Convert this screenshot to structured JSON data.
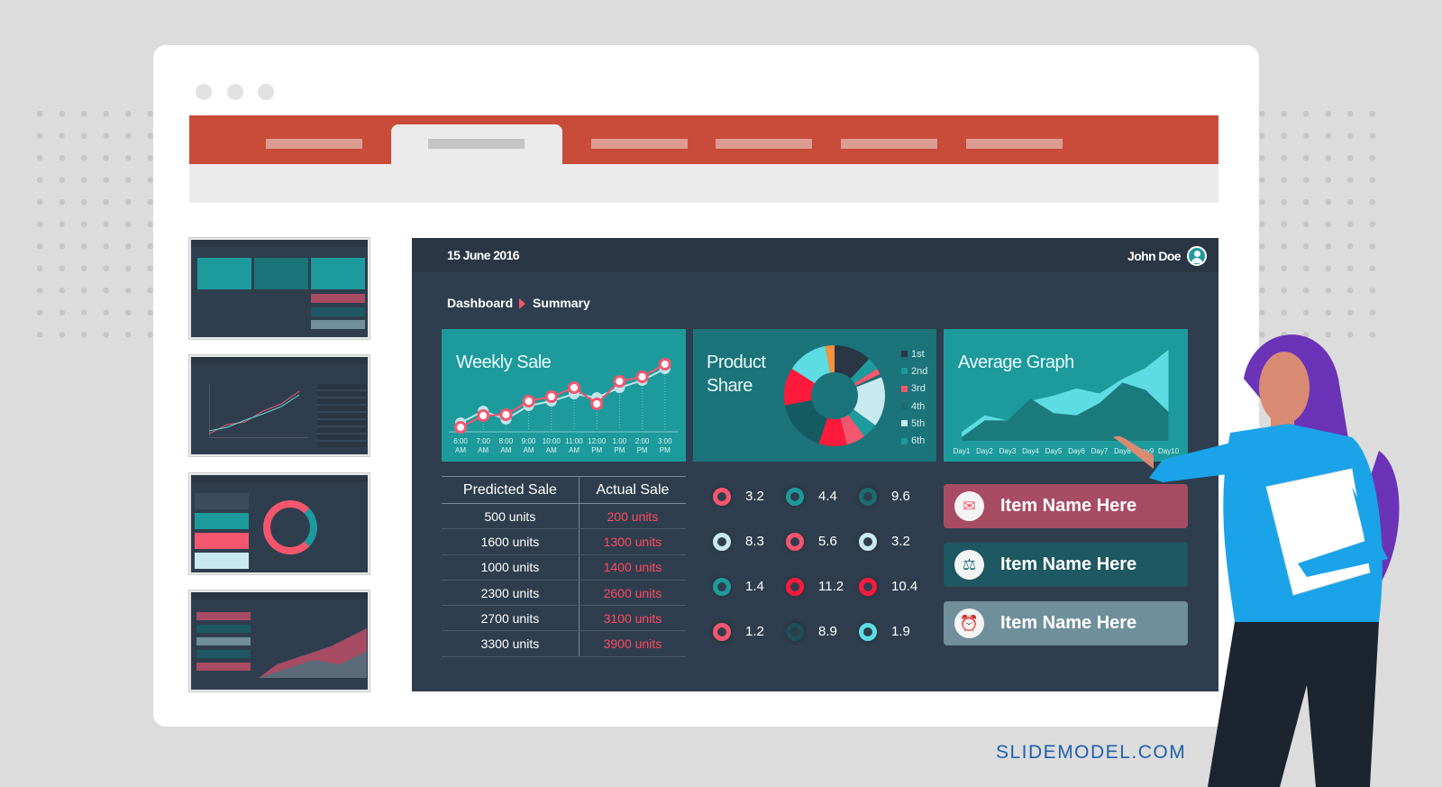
{
  "dashboard": {
    "date": "15 June 2016",
    "user": "John Doe",
    "breadcrumb": [
      "Dashboard",
      "Summary"
    ],
    "weekly_sale": {
      "title": "Weekly Sale",
      "chart_data": {
        "type": "line",
        "categories": [
          "6:00 AM",
          "7:00 AM",
          "8:00 AM",
          "9:00 AM",
          "10:00 AM",
          "11:00 AM",
          "12:00 PM",
          "1:00 PM",
          "2:00 PM",
          "3:00 PM"
        ],
        "series": [
          {
            "color": "#f4566e",
            "values": [
              3,
              16,
              17,
              32,
              37,
              47,
              29,
              54,
              59,
              73
            ]
          },
          {
            "color": "#bfe6ec",
            "values": [
              8,
              21,
              12,
              27,
              32,
              40,
              36,
              47,
              55,
              68
            ]
          }
        ],
        "ylim": [
          0,
          80
        ]
      }
    },
    "product_share": {
      "title": [
        "Product",
        "Share"
      ],
      "legend": [
        {
          "label": "1st",
          "color": "#2a3644"
        },
        {
          "label": "2nd",
          "color": "#1d9a9c"
        },
        {
          "label": "3rd",
          "color": "#f4566e"
        },
        {
          "label": "4th",
          "color": "#1b6b70"
        },
        {
          "label": "5th",
          "color": "#c8e9ef"
        },
        {
          "label": "6th",
          "color": "#1d9a9c"
        }
      ],
      "chart_data": {
        "type": "pie",
        "values": [
          12,
          4,
          2,
          1,
          16,
          5,
          6,
          9,
          17,
          12,
          13,
          3
        ],
        "colors": [
          "#2a3644",
          "#1d9a9c",
          "#f4566e",
          "#1b6b70",
          "#c8e9ef",
          "#1d9a9c",
          "#f4566e",
          "#ff1a3c",
          "#165a62",
          "#ff1a3c",
          "#5ddde3",
          "#f7923a"
        ]
      }
    },
    "average_graph": {
      "title": "Average Graph",
      "chart_data": {
        "type": "area",
        "categories": [
          "Day1",
          "Day2",
          "Day3",
          "Day4",
          "Day5",
          "Day6",
          "Day7",
          "Day8",
          "Day9",
          "Day10"
        ],
        "series": [
          {
            "color": "#5ddde3",
            "values": [
              12,
              35,
              28,
              55,
              62,
              72,
              65,
              85,
              100,
              125
            ]
          },
          {
            "color": "#1b7a7c",
            "values": [
              5,
              28,
              28,
              58,
              38,
              35,
              52,
              80,
              70,
              40
            ]
          }
        ],
        "ylim": [
          0,
          130
        ]
      }
    },
    "table": {
      "headers": [
        "Predicted Sale",
        "Actual Sale"
      ],
      "rows": [
        [
          "500 units",
          "200 units"
        ],
        [
          "1600 units",
          "1300 units"
        ],
        [
          "1000 units",
          "1400 units"
        ],
        [
          "2300 units",
          "2600 units"
        ],
        [
          "2700 units",
          "3100 units"
        ],
        [
          "3300 units",
          "3900 units"
        ]
      ]
    },
    "indicators": [
      [
        {
          "v": "3.2",
          "c": "#f4566e"
        },
        {
          "v": "4.4",
          "c": "#1d9a9c"
        },
        {
          "v": "9.6",
          "c": "#1b6b70"
        }
      ],
      [
        {
          "v": "8.3",
          "c": "#c8e9ef"
        },
        {
          "v": "5.6",
          "c": "#f4566e"
        },
        {
          "v": "3.2",
          "c": "#c8e9ef"
        }
      ],
      [
        {
          "v": "1.4",
          "c": "#1d9a9c"
        },
        {
          "v": "11.2",
          "c": "#ff1a3c"
        },
        {
          "v": "10.4",
          "c": "#ff1a3c"
        }
      ],
      [
        {
          "v": "1.2",
          "c": "#f4566e"
        },
        {
          "v": "8.9",
          "c": "#1e4f5a"
        },
        {
          "v": "1.9",
          "c": "#5ddde3"
        }
      ]
    ],
    "items": [
      {
        "label": "Item Name Here",
        "icon": "mail-icon",
        "color": "#a84c63"
      },
      {
        "label": "Item Name Here",
        "icon": "scale-icon",
        "color": "#1e5862"
      },
      {
        "label": "Item Name Here",
        "icon": "alarm-clock-icon",
        "color": "#6f8f9a"
      }
    ]
  },
  "watermark": "SLIDEMODEL.COM"
}
